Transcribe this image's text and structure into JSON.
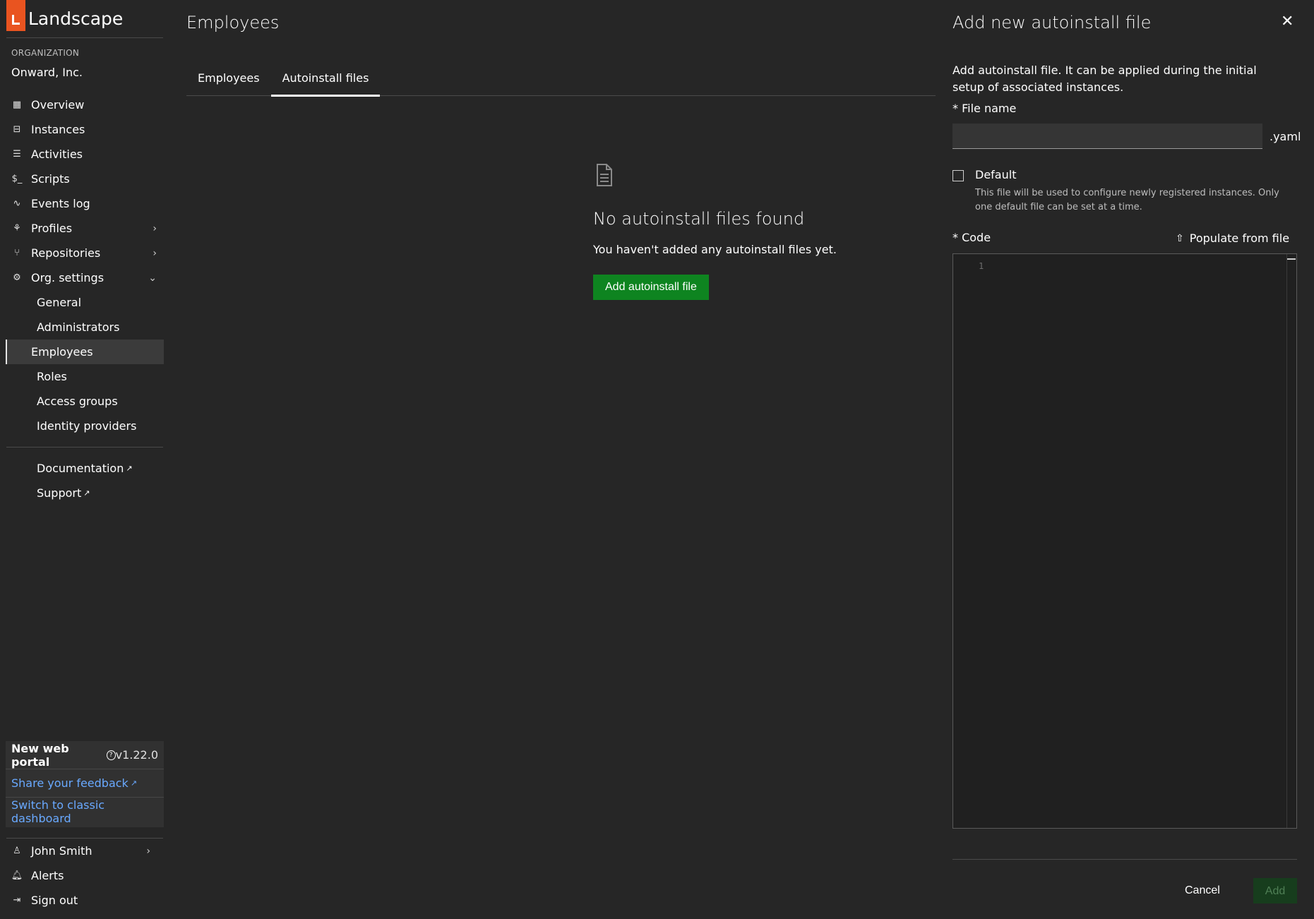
{
  "sidebar": {
    "brand": "Landscape",
    "org_label": "ORGANIZATION",
    "org_name": "Onward, Inc.",
    "items": [
      {
        "label": "Overview",
        "icon": "grid-icon"
      },
      {
        "label": "Instances",
        "icon": "server-icon"
      },
      {
        "label": "Activities",
        "icon": "list-icon"
      },
      {
        "label": "Scripts",
        "icon": "terminal-icon"
      },
      {
        "label": "Events log",
        "icon": "pulse-icon"
      },
      {
        "label": "Profiles",
        "icon": "cluster-icon"
      },
      {
        "label": "Repositories",
        "icon": "branch-icon"
      },
      {
        "label": "Org. settings",
        "icon": "gear-icon"
      }
    ],
    "sub_items": [
      "General",
      "Administrators",
      "Employees",
      "Roles",
      "Access groups",
      "Identity providers"
    ],
    "links": [
      "Documentation",
      "Support"
    ],
    "portal": {
      "title": "New web portal",
      "version": "v1.22.0",
      "feedback": "Share your feedback",
      "switch": "Switch to classic dashboard"
    },
    "user": {
      "name": "John Smith",
      "alerts": "Alerts",
      "signout": "Sign out"
    }
  },
  "main": {
    "title": "Employees",
    "tabs": [
      "Employees",
      "Autoinstall files"
    ],
    "empty_title": "No autoinstall files found",
    "empty_sub": "You haven't added any autoinstall files yet.",
    "add_button": "Add autoinstall file"
  },
  "drawer": {
    "title": "Add new autoinstall file",
    "description": "Add autoinstall file. It can be applied during the initial setup of associated instances.",
    "file_name_label": "* File name",
    "file_name_value": "",
    "suffix": ".yaml",
    "default_label": "Default",
    "default_help": "This file will be used to configure newly registered instances. Only one default file can be set at a time.",
    "code_label": "* Code",
    "populate": "Populate from file",
    "line_number": "1",
    "cancel": "Cancel",
    "add": "Add"
  }
}
